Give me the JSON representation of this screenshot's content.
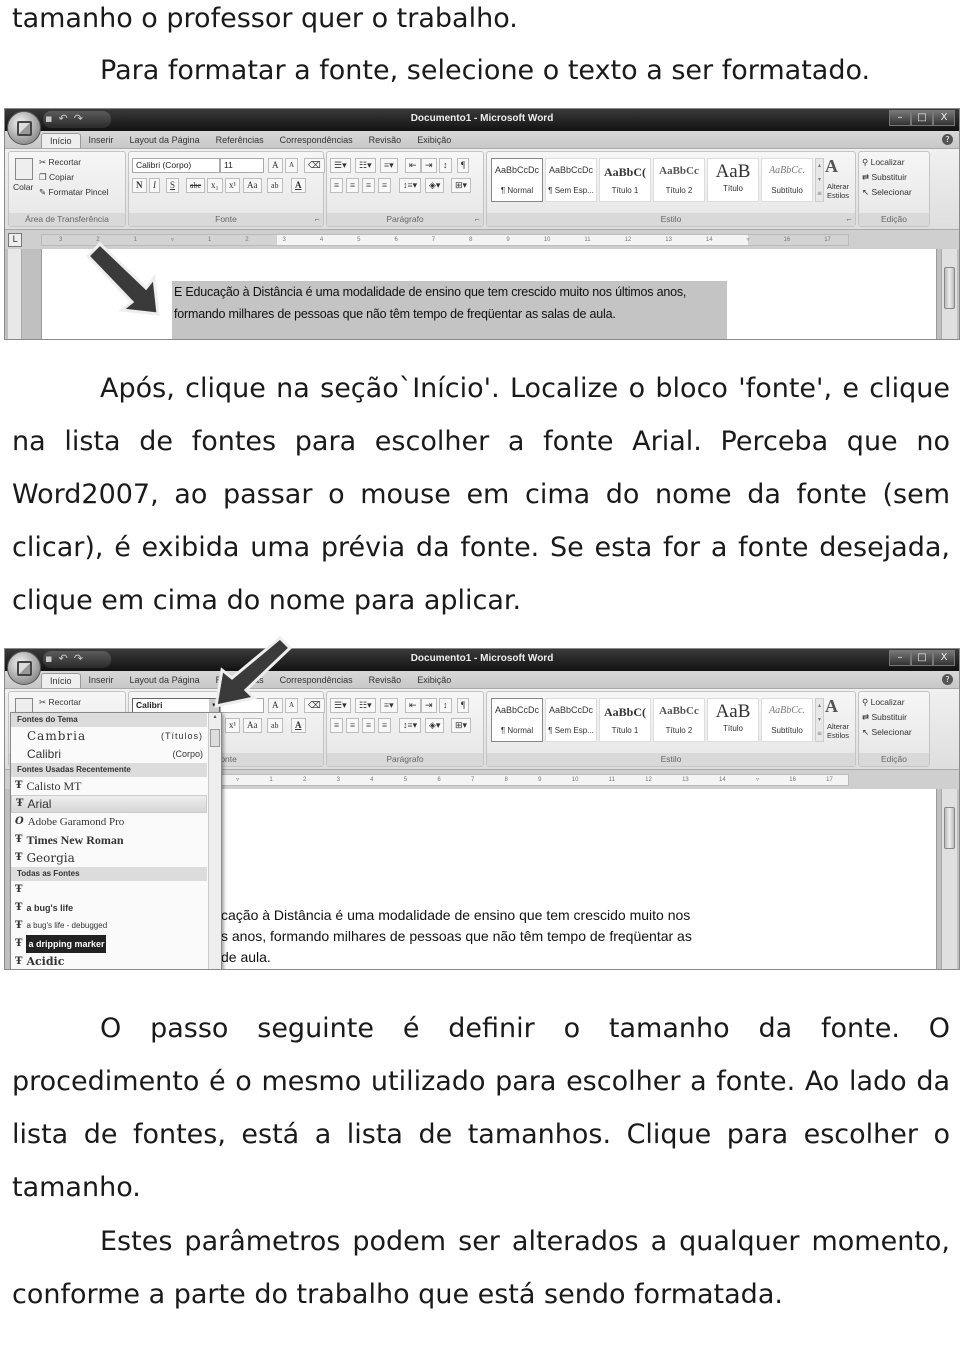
{
  "intro": {
    "line1": "tamanho o professor quer o trabalho.",
    "line2": "Para formatar a fonte, selecione o texto a ser formatado."
  },
  "word": {
    "title": "Documento1 - Microsoft Word",
    "window_controls": [
      "–",
      "□",
      "X"
    ],
    "tabs": [
      "Início",
      "Inserir",
      "Layout da Página",
      "Referências",
      "Correspondências",
      "Revisão",
      "Exibição"
    ],
    "clipboard": {
      "paste": "Colar",
      "cut": "Recortar",
      "copy": "Copiar",
      "format_painter": "Formatar Pincel",
      "label": "Área de Transferência"
    },
    "font_group": {
      "font_name": "Calibri (Corpo)",
      "font_name_selected": "Calibri",
      "font_size": "11",
      "grow": "A",
      "shrink": "A",
      "bold": "N",
      "italic": "I",
      "underline": "S",
      "strike": "abc",
      "subscript": "x₁",
      "superscript": "x¹",
      "case": "Aa",
      "highlight": "ab",
      "color": "A",
      "label": "Fonte"
    },
    "paragraph_label": "Parágrafo",
    "styles": [
      {
        "preview": "AaBbCcDc",
        "name": "¶ Normal"
      },
      {
        "preview": "AaBbCcDc",
        "name": "¶ Sem Esp..."
      },
      {
        "preview": "AaBbC(",
        "name": "Título 1"
      },
      {
        "preview": "AaBbCc",
        "name": "Título 2"
      },
      {
        "preview": "AaB",
        "name": "Título"
      },
      {
        "preview": "AaBbCc.",
        "name": "Subtítulo"
      }
    ],
    "change_styles": "Alterar Estilos",
    "styles_label": "Estilo",
    "editing": {
      "find": "Localizar",
      "replace": "Substituir",
      "select": "Selecionar",
      "label": "Edição"
    },
    "ruler_corner": "L",
    "ruler_ticks": [
      "3",
      "2",
      "1",
      "",
      "1",
      "2",
      "3",
      "4",
      "5",
      "6",
      "7",
      "8",
      "9",
      "10",
      "11",
      "12",
      "13",
      "14",
      "",
      "16",
      "17"
    ]
  },
  "screenshot1": {
    "selected_text_line1": "E Educação à Distância é uma modalidade de ensino que tem crescido muito nos últimos anos,",
    "selected_text_line2": "formando milhares de pessoas que não têm tempo de freqüentar as salas de aula."
  },
  "middle_paragraph": "Após, clique na seção`Início'. Localize o bloco 'fonte', e clique na lista de fontes para escolher a fonte Arial. Perceba que no Word2007, ao passar o mouse em cima do nome da fonte (sem clicar), é exibida uma prévia da fonte. Se esta for a fonte desejada, clique em cima do nome para aplicar.",
  "font_dropdown": {
    "theme_header": "Fontes do Tema",
    "theme_fonts": [
      {
        "name": "Cambria",
        "tag": "(Títulos)"
      },
      {
        "name": "Calibri",
        "tag": "(Corpo)"
      }
    ],
    "recent_header": "Fontes Usadas Recentemente",
    "recent_fonts": [
      "Calisto MT",
      "Arial",
      "Adobe Garamond Pro",
      "Times New Roman",
      "Georgia"
    ],
    "hovered_font": "Arial",
    "all_header": "Todas as Fontes",
    "all_fonts": [
      "",
      "a bug's life",
      "a bug's life - debugged",
      "a dripping marker",
      "Acidic"
    ]
  },
  "screenshot2": {
    "preview_line1": "cação à Distância é uma modalidade de ensino que tem crescido muito nos",
    "preview_line2": "s anos, formando milhares de pessoas que não têm tempo de freqüentar as",
    "preview_line3": "de aula."
  },
  "closing": {
    "para1": "O passo seguinte é definir o tamanho da fonte. O procedimento é o mesmo utilizado para escolher a fonte. Ao lado da lista de fontes, está a lista de  tamanhos. Clique para escolher o tamanho.",
    "para2": "Estes parâmetros podem ser alterados a qualquer momento, conforme a parte do trabalho que está sendo formatada."
  }
}
